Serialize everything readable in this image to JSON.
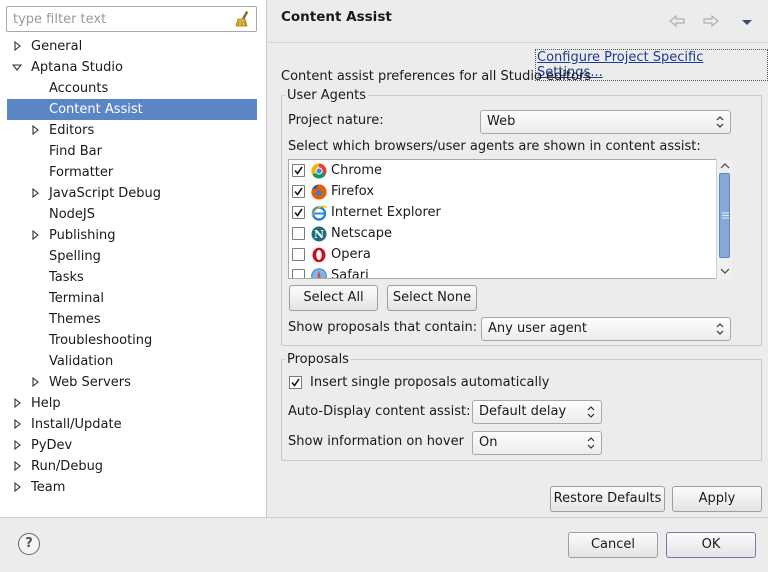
{
  "sidebar": {
    "filter_placeholder": "type filter text",
    "items": [
      {
        "label": "General",
        "level": 0,
        "state": "collapsed"
      },
      {
        "label": "Aptana Studio",
        "level": 0,
        "state": "expanded"
      },
      {
        "label": "Accounts",
        "level": 1,
        "state": "leaf"
      },
      {
        "label": "Content Assist",
        "level": 1,
        "state": "leaf",
        "selected": true
      },
      {
        "label": "Editors",
        "level": 1,
        "state": "collapsed"
      },
      {
        "label": "Find Bar",
        "level": 1,
        "state": "leaf"
      },
      {
        "label": "Formatter",
        "level": 1,
        "state": "leaf"
      },
      {
        "label": "JavaScript Debug",
        "level": 1,
        "state": "collapsed"
      },
      {
        "label": "NodeJS",
        "level": 1,
        "state": "leaf"
      },
      {
        "label": "Publishing",
        "level": 1,
        "state": "collapsed"
      },
      {
        "label": "Spelling",
        "level": 1,
        "state": "leaf"
      },
      {
        "label": "Tasks",
        "level": 1,
        "state": "leaf"
      },
      {
        "label": "Terminal",
        "level": 1,
        "state": "leaf"
      },
      {
        "label": "Themes",
        "level": 1,
        "state": "leaf"
      },
      {
        "label": "Troubleshooting",
        "level": 1,
        "state": "leaf"
      },
      {
        "label": "Validation",
        "level": 1,
        "state": "leaf"
      },
      {
        "label": "Web Servers",
        "level": 1,
        "state": "collapsed"
      },
      {
        "label": "Help",
        "level": 0,
        "state": "collapsed"
      },
      {
        "label": "Install/Update",
        "level": 0,
        "state": "collapsed"
      },
      {
        "label": "PyDev",
        "level": 0,
        "state": "collapsed"
      },
      {
        "label": "Run/Debug",
        "level": 0,
        "state": "collapsed"
      },
      {
        "label": "Team",
        "level": 0,
        "state": "collapsed"
      }
    ]
  },
  "header": {
    "title": "Content Assist",
    "back_icon": "back-arrow-icon",
    "forward_icon": "forward-arrow-icon",
    "menu_icon": "view-menu-icon"
  },
  "content": {
    "configure_link": "Configure Project Specific Settings...",
    "description": "Content assist preferences for all Studio editors",
    "user_agents": {
      "legend": "User Agents",
      "project_nature_label": "Project nature:",
      "project_nature_value": "Web",
      "select_label": "Select which browsers/user agents are shown in content assist:",
      "browsers": [
        {
          "name": "Chrome",
          "checked": true,
          "icon": "chrome-icon"
        },
        {
          "name": "Firefox",
          "checked": true,
          "icon": "firefox-icon"
        },
        {
          "name": "Internet Explorer",
          "checked": true,
          "icon": "internet-explorer-icon"
        },
        {
          "name": "Netscape",
          "checked": false,
          "icon": "netscape-icon"
        },
        {
          "name": "Opera",
          "checked": false,
          "icon": "opera-icon"
        },
        {
          "name": "Safari",
          "checked": false,
          "icon": "safari-icon"
        }
      ],
      "select_all_label": "Select All",
      "select_none_label": "Select None",
      "show_proposals_label": "Show proposals that contain:",
      "show_proposals_value": "Any user agent"
    },
    "proposals": {
      "legend": "Proposals",
      "insert_single_label": "Insert single proposals automatically",
      "insert_single_checked": true,
      "auto_display_label": "Auto-Display content assist:",
      "auto_display_value": "Default delay",
      "show_info_label": "Show information on hover",
      "show_info_value": "On"
    },
    "restore_defaults_label": "Restore Defaults",
    "apply_label": "Apply"
  },
  "footer": {
    "help_symbol": "?",
    "cancel_label": "Cancel",
    "ok_label": "OK"
  },
  "colors": {
    "selection": "#5b86c5",
    "link": "#1a3c8c",
    "chrome_red": "#db4437",
    "chrome_green": "#0f9d58",
    "chrome_yellow": "#f4b400",
    "firefox_orange": "#e66000",
    "ie_blue": "#1e88e5",
    "netscape_teal": "#1f6f7a",
    "opera_red": "#cc0f16"
  }
}
